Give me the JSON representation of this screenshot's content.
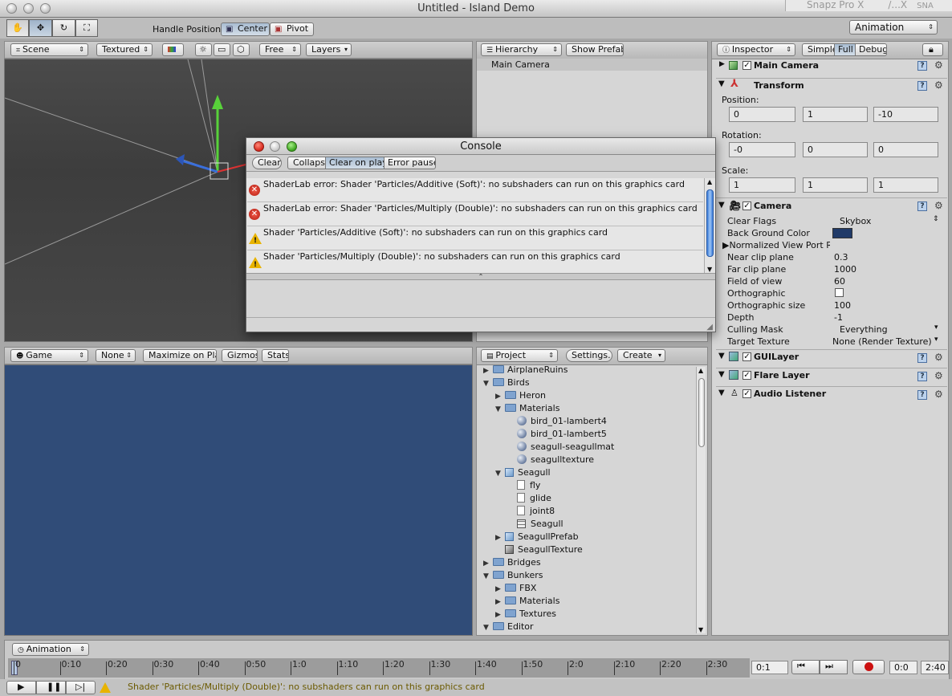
{
  "window": {
    "title": "Untitled - Island Demo",
    "snapz": "Snapz Pro X",
    "snapz_tail": "/...X",
    "snapz_sna": "SNA"
  },
  "toolbar": {
    "handle_label": "Handle Position:",
    "center_label": "Center",
    "pivot_label": "Pivot",
    "layout_dropdown": "Animation"
  },
  "scene": {
    "view_dropdown": "Scene",
    "render_dropdown": "Textured",
    "camera_mode": "Free",
    "layers_dropdown": "Layers"
  },
  "hierarchy": {
    "dropdown": "Hierarchy",
    "show_prefab_label": "Show Prefab",
    "items": [
      "Main Camera"
    ]
  },
  "console": {
    "title": "Console",
    "clear_label": "Clear",
    "collapse_label": "Collapse",
    "clear_on_play_label": "Clear on play",
    "error_pause_label": "Error pause",
    "messages": [
      {
        "type": "error",
        "text": "ShaderLab error: Shader 'Particles/Additive (Soft)': no subshaders can run on this graphics card"
      },
      {
        "type": "error",
        "text": "ShaderLab error: Shader 'Particles/Multiply (Double)': no subshaders can run on this graphics card"
      },
      {
        "type": "warning",
        "text": "Shader 'Particles/Additive (Soft)': no subshaders can run on this graphics card"
      },
      {
        "type": "warning",
        "text": "Shader 'Particles/Multiply (Double)': no subshaders can run on this graphics card"
      }
    ]
  },
  "game": {
    "dropdown": "Game",
    "aspect_dropdown": "None",
    "maximize_label": "Maximize on Play",
    "gizmos_label": "Gizmos",
    "stats_label": "Stats",
    "background_color": "#304c78"
  },
  "project": {
    "dropdown": "Project",
    "settings_label": "Settings...",
    "create_label": "Create",
    "items": [
      {
        "label": "AirplaneRuins",
        "kind": "folder",
        "open": false,
        "depth": 0
      },
      {
        "label": "Birds",
        "kind": "folder",
        "open": true,
        "depth": 0
      },
      {
        "label": "Heron",
        "kind": "folder",
        "open": false,
        "depth": 1
      },
      {
        "label": "Materials",
        "kind": "folder",
        "open": true,
        "depth": 1
      },
      {
        "label": "bird_01-lambert4",
        "kind": "material",
        "depth": 2
      },
      {
        "label": "bird_01-lambert5",
        "kind": "material",
        "depth": 2
      },
      {
        "label": "seagull-seagullmat",
        "kind": "material",
        "depth": 2
      },
      {
        "label": "seagulltexture",
        "kind": "material",
        "depth": 2
      },
      {
        "label": "Seagull",
        "kind": "model",
        "open": true,
        "depth": 1
      },
      {
        "label": "fly",
        "kind": "anim",
        "depth": 2
      },
      {
        "label": "glide",
        "kind": "anim",
        "depth": 2
      },
      {
        "label": "joint8",
        "kind": "mesh",
        "depth": 2
      },
      {
        "label": "Seagull",
        "kind": "grid",
        "depth": 2
      },
      {
        "label": "SeagullPrefab",
        "kind": "prefab",
        "open": false,
        "depth": 1
      },
      {
        "label": "SeagullTexture",
        "kind": "texture",
        "depth": 1
      },
      {
        "label": "Bridges",
        "kind": "folder",
        "open": false,
        "depth": 0
      },
      {
        "label": "Bunkers",
        "kind": "folder",
        "open": true,
        "depth": 0
      },
      {
        "label": "FBX",
        "kind": "folder",
        "open": false,
        "depth": 1
      },
      {
        "label": "Materials",
        "kind": "folder",
        "open": false,
        "depth": 1
      },
      {
        "label": "Textures",
        "kind": "folder",
        "open": false,
        "depth": 1
      },
      {
        "label": "Editor",
        "kind": "folder",
        "open": true,
        "depth": 0
      }
    ]
  },
  "inspector": {
    "dropdown": "Inspector",
    "modes": [
      "Simple",
      "Full",
      "Debug"
    ],
    "object_name": "Main Camera",
    "transform_label": "Transform",
    "position_label": "Position:",
    "position": [
      "0",
      "1",
      "-10"
    ],
    "rotation_label": "Rotation:",
    "rotation": [
      "-0",
      "0",
      "0"
    ],
    "scale_label": "Scale:",
    "scale": [
      "1",
      "1",
      "1"
    ],
    "camera_label": "Camera",
    "camera_props": [
      {
        "name": "Clear Flags",
        "value": "Skybox"
      },
      {
        "name": "Back Ground Color",
        "value": ""
      },
      {
        "name": "Normalized View Port Re",
        "value": ""
      },
      {
        "name": "Near clip plane",
        "value": "0.3"
      },
      {
        "name": "Far clip plane",
        "value": "1000"
      },
      {
        "name": "Field of view",
        "value": "60"
      },
      {
        "name": "Orthographic",
        "value": ""
      },
      {
        "name": "Orthographic size",
        "value": "100"
      },
      {
        "name": "Depth",
        "value": "-1"
      },
      {
        "name": "Culling Mask",
        "value": "Everything"
      },
      {
        "name": "Target Texture",
        "value": "None (Render Texture)"
      }
    ],
    "background_color_swatch": "#203a68",
    "components": [
      "GUILayer",
      "Flare Layer",
      "Audio Listener"
    ]
  },
  "animation": {
    "dropdown": "Animation",
    "ticks": [
      "0",
      "0:10",
      "0:20",
      "0:30",
      "0:40",
      "0:50",
      "1:0",
      "1:10",
      "1:20",
      "1:30",
      "1:40",
      "1:50",
      "2:0",
      "2:10",
      "2:20",
      "2:30"
    ],
    "frame_field": "0:1",
    "start_field": "0:0",
    "end_field": "2:40"
  },
  "status": {
    "message": "Shader 'Particles/Multiply (Double)': no subshaders can run on this graphics card"
  }
}
